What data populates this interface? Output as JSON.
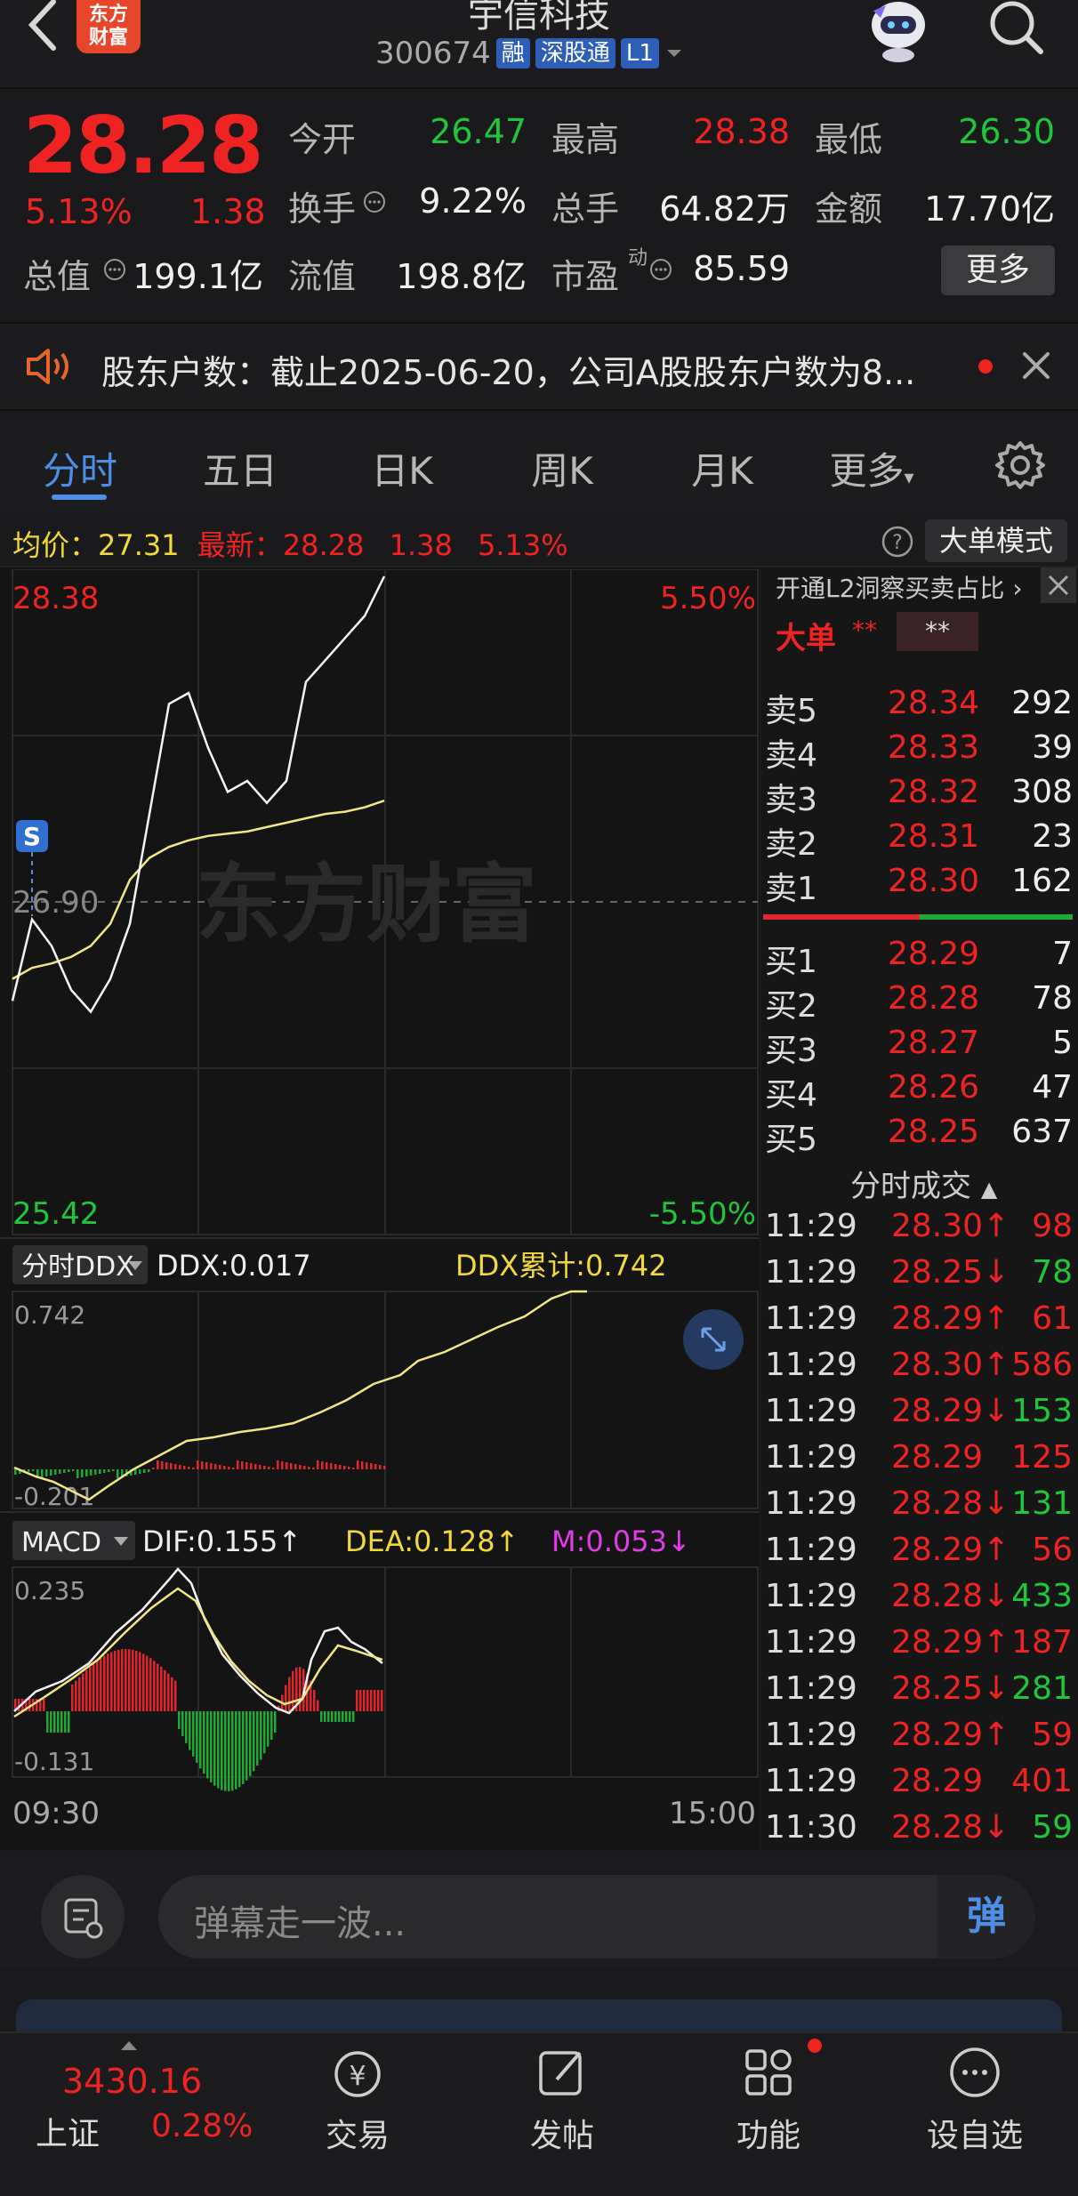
{
  "header": {
    "logo_text_1": "东方",
    "logo_text_2": "财富",
    "stock_name": "宇信科技",
    "stock_code": "300674",
    "tags": [
      "融",
      "深股通",
      "L1"
    ]
  },
  "quote": {
    "price": "28.28",
    "change_pct": "5.13%",
    "change": "1.38",
    "fields": [
      {
        "label": "今开",
        "value": "26.47",
        "color": "green"
      },
      {
        "label": "最高",
        "value": "28.38",
        "color": "red"
      },
      {
        "label": "最低",
        "value": "26.30",
        "color": "green"
      },
      {
        "label": "换手",
        "value": "9.22%",
        "color": "white"
      },
      {
        "label": "总手",
        "value": "64.82万",
        "color": "white"
      },
      {
        "label": "金额",
        "value": "17.70亿",
        "color": "white"
      },
      {
        "label": "总值",
        "value": "199.1亿",
        "color": "white"
      },
      {
        "label": "流值",
        "value": "198.8亿",
        "color": "white"
      },
      {
        "label": "市盈",
        "value": "85.59",
        "color": "white"
      }
    ],
    "pe_sup": "动",
    "more_label": "更多"
  },
  "notice": {
    "text": "股东户数：截止2025-06-20，公司A股股东户数为8..."
  },
  "tabs": [
    "分时",
    "五日",
    "日K",
    "周K",
    "月K",
    "更多"
  ],
  "infobar": {
    "avg_label": "均价：",
    "avg_value": "27.31",
    "latest_label": "最新：",
    "latest_value": "28.28",
    "latest_chg": "1.38",
    "latest_pct": "5.13%",
    "mode_button": "大单模式"
  },
  "chart": {
    "price_high": "28.38",
    "price_low": "25.42",
    "pct_high": "5.50%",
    "pct_low": "-5.50%",
    "base_price": "26.90",
    "watermark": "东方财富",
    "marker": "S",
    "time_start": "09:30",
    "time_end": "15:00"
  },
  "chart_data": {
    "type": "line",
    "title": "",
    "ylim": [
      25.42,
      28.38
    ],
    "xlabel": "",
    "ylabel": "",
    "series": [
      {
        "values": [
          26.45,
          26.82,
          26.7,
          26.5,
          26.4,
          26.55,
          26.8,
          27.3,
          27.8,
          27.85,
          27.6,
          27.4,
          27.45,
          27.35,
          27.45,
          27.9,
          28.0,
          28.1,
          28.2,
          28.38
        ]
      },
      {
        "values": [
          26.55,
          26.6,
          26.62,
          26.65,
          26.7,
          26.8,
          27.0,
          27.1,
          27.15,
          27.18,
          27.2,
          27.21,
          27.22,
          27.24,
          27.26,
          27.28,
          27.3,
          27.31,
          27.33,
          27.36
        ]
      }
    ]
  },
  "ddx": {
    "selector": "分时DDX",
    "ddx_label": "DDX:0.017",
    "ddx_cum_label": "DDX累计:0.742",
    "top": "0.742",
    "bottom": "-0.201"
  },
  "macd": {
    "selector": "MACD",
    "dif": "DIF:0.155↑",
    "dea": "DEA:0.128↑",
    "m": "M:0.053↓",
    "top": "0.235",
    "bottom": "-0.131"
  },
  "book": {
    "header": "开通L2洞察买卖占比",
    "big_label": "大单",
    "big_stars_1": "**",
    "big_stars_2": "**",
    "sells": [
      {
        "label": "卖5",
        "price": "28.34",
        "vol": "292"
      },
      {
        "label": "卖4",
        "price": "28.33",
        "vol": "39"
      },
      {
        "label": "卖3",
        "price": "28.32",
        "vol": "308"
      },
      {
        "label": "卖2",
        "price": "28.31",
        "vol": "23"
      },
      {
        "label": "卖1",
        "price": "28.30",
        "vol": "162"
      }
    ],
    "buys": [
      {
        "label": "买1",
        "price": "28.29",
        "vol": "7"
      },
      {
        "label": "买2",
        "price": "28.28",
        "vol": "78"
      },
      {
        "label": "买3",
        "price": "28.27",
        "vol": "5"
      },
      {
        "label": "买4",
        "price": "28.26",
        "vol": "47"
      },
      {
        "label": "买5",
        "price": "28.25",
        "vol": "637"
      }
    ],
    "ticks_header": "分时成交",
    "ticks": [
      {
        "time": "11:29",
        "price": "28.30↑",
        "vol": "98",
        "dir": "red"
      },
      {
        "time": "11:29",
        "price": "28.25↓",
        "vol": "78",
        "dir": "green"
      },
      {
        "time": "11:29",
        "price": "28.29↑",
        "vol": "61",
        "dir": "red"
      },
      {
        "time": "11:29",
        "price": "28.30↑",
        "vol": "586",
        "dir": "red"
      },
      {
        "time": "11:29",
        "price": "28.29↓",
        "vol": "153",
        "dir": "green"
      },
      {
        "time": "11:29",
        "price": "28.29",
        "vol": "125",
        "dir": "red"
      },
      {
        "time": "11:29",
        "price": "28.28↓",
        "vol": "131",
        "dir": "green"
      },
      {
        "time": "11:29",
        "price": "28.29↑",
        "vol": "56",
        "dir": "red"
      },
      {
        "time": "11:29",
        "price": "28.28↓",
        "vol": "433",
        "dir": "green"
      },
      {
        "time": "11:29",
        "price": "28.29↑",
        "vol": "187",
        "dir": "red"
      },
      {
        "time": "11:29",
        "price": "28.25↓",
        "vol": "281",
        "dir": "green"
      },
      {
        "time": "11:29",
        "price": "28.29↑",
        "vol": "59",
        "dir": "red"
      },
      {
        "time": "11:29",
        "price": "28.29",
        "vol": "401",
        "dir": "red"
      },
      {
        "time": "11:30",
        "price": "28.28↓",
        "vol": "59",
        "dir": "green"
      }
    ]
  },
  "danmu": {
    "placeholder": "弹幕走一波...",
    "send_label": "弹"
  },
  "nav": {
    "index_value": "3430.16",
    "index_name": "上证",
    "index_pct": "0.28%",
    "items": [
      "交易",
      "发帖",
      "功能",
      "设自选"
    ]
  }
}
